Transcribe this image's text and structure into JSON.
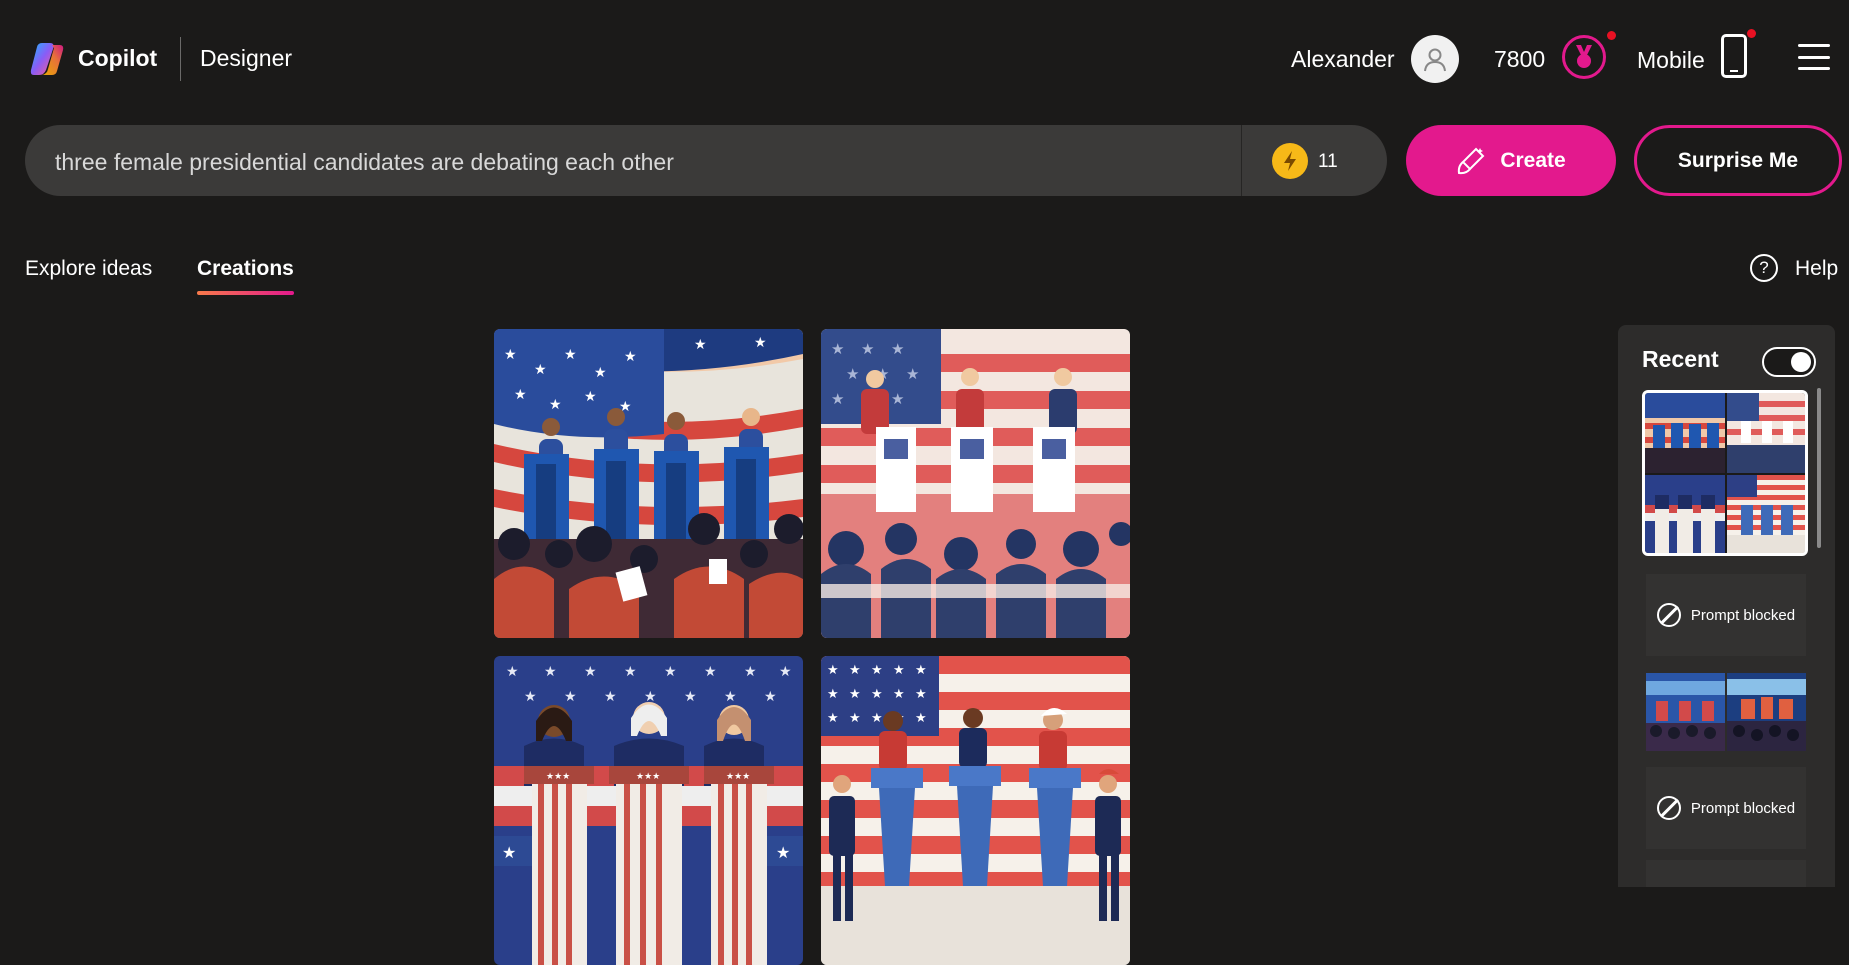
{
  "header": {
    "brand": "Copilot",
    "product": "Designer",
    "user_name": "Alexander",
    "points": "7800",
    "mobile_label": "Mobile"
  },
  "prompt": {
    "text": "three female presidential candidates are debating each other",
    "boost_count": "11"
  },
  "actions": {
    "create_label": "Create",
    "surprise_label": "Surprise Me"
  },
  "tabs": [
    {
      "label": "Explore ideas",
      "active": false
    },
    {
      "label": "Creations",
      "active": true
    }
  ],
  "help_label": "Help",
  "recent": {
    "title": "Recent",
    "toggle_on": true,
    "items": [
      {
        "type": "image-set"
      },
      {
        "type": "blocked",
        "label": "Prompt blocked"
      },
      {
        "type": "image-set"
      },
      {
        "type": "blocked",
        "label": "Prompt blocked"
      }
    ]
  },
  "colors": {
    "accent": "#e3198d",
    "background": "#1b1a19",
    "prompt_bg": "#3b3a39",
    "boost": "#f7b918",
    "notification": "#e81123"
  },
  "icons": [
    "copilot-logo-icon",
    "user-icon",
    "rewards-medal-icon",
    "phone-icon",
    "hamburger-menu-icon",
    "boost-bolt-icon",
    "create-brush-icon",
    "help-icon",
    "blocked-icon"
  ]
}
